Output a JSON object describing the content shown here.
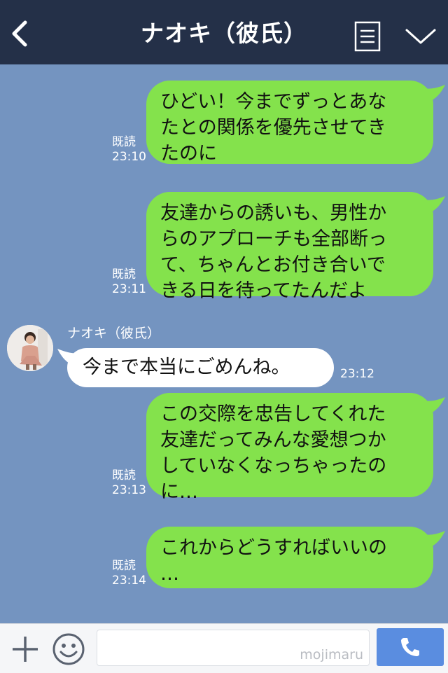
{
  "header": {
    "title": "ナオキ（彼氏）"
  },
  "messages": [
    {
      "lines": [
        "ひどい！今までずっとあな",
        "たとの関係を優先させてき",
        "たのに"
      ],
      "read": "既読",
      "time": "23:10"
    },
    {
      "lines": [
        "友達からの誘いも、男性か",
        "らのアプローチも全部断っ",
        "て、ちゃんとお付き合いで",
        "きる日を待ってたんだよ"
      ],
      "read": "既読",
      "time": "23:11"
    },
    {
      "sender": "ナオキ（彼氏）",
      "text": "今まで本当にごめんね。",
      "time": "23:12"
    },
    {
      "lines": [
        "この交際を忠告してくれた",
        "友達だってみんな愛想つか",
        "していなくなっちゃったの",
        "に…"
      ],
      "read": "既読",
      "time": "23:13"
    },
    {
      "lines": [
        "これからどうすればいいの",
        "…"
      ],
      "read": "既読",
      "time": "23:14"
    }
  ],
  "input": {
    "watermark": "mojimaru"
  },
  "icons": {
    "back": "back-chevron-icon",
    "menu": "menu-list-icon",
    "expand": "chevron-down-icon",
    "plus": "plus-icon",
    "emoji": "emoji-icon",
    "call": "phone-icon"
  },
  "colors": {
    "header": "#243048",
    "chat_background": "#7494c0",
    "outgoing_bubble": "#84e24c",
    "incoming_bubble": "#ffffff",
    "call_button": "#5a8de0"
  }
}
